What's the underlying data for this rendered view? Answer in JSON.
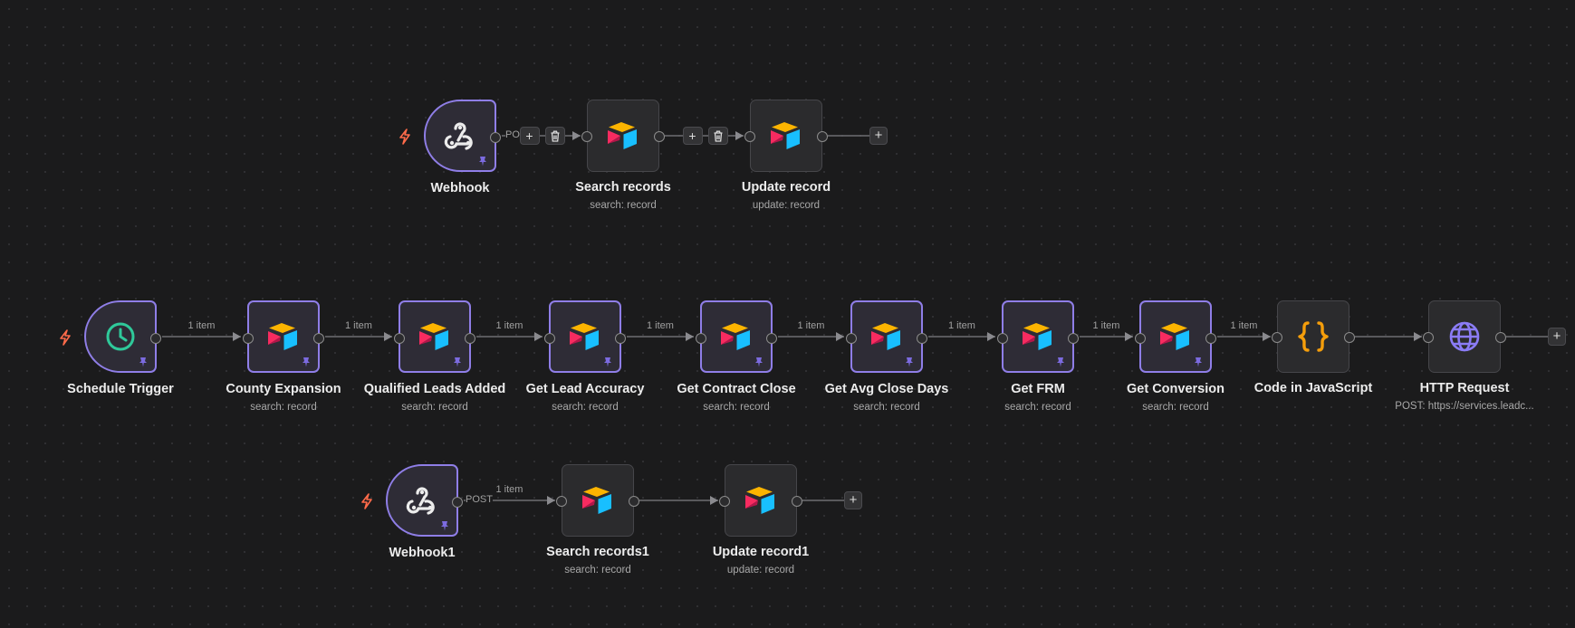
{
  "colors": {
    "canvas_bg": "#1b1b1c",
    "node_bg": "#2b2b2d",
    "pinned_border": "#8f7ee7",
    "trigger_bolt": "#ff6b4a",
    "schedule_icon": "#2fc99a",
    "code_icon": "#f59e0b",
    "http_icon": "#8b7cf6",
    "airtable_yellow": "#fcb400",
    "airtable_blue": "#18bfff",
    "airtable_red": "#f82b60"
  },
  "workflow_rows": [
    {
      "id": "row1",
      "nodes": [
        {
          "id": "webhook",
          "label": "Webhook",
          "subtitle": "",
          "icon": "webhook-icon",
          "trigger": true,
          "pinned": true
        },
        {
          "id": "search-records",
          "label": "Search records",
          "subtitle": "search: record",
          "icon": "airtable-icon",
          "trigger": false,
          "pinned": false
        },
        {
          "id": "update-record",
          "label": "Update record",
          "subtitle": "update: record",
          "icon": "airtable-icon",
          "trigger": false,
          "pinned": false
        }
      ],
      "edges": [
        {
          "from": "webhook",
          "to": "search-records",
          "label": "PO",
          "hover_controls": [
            "+",
            "delete"
          ]
        },
        {
          "from": "search-records",
          "to": "update-record",
          "label": "",
          "hover_controls": [
            "+",
            "delete"
          ]
        }
      ],
      "end_add": "+"
    },
    {
      "id": "row2",
      "nodes": [
        {
          "id": "schedule-trigger",
          "label": "Schedule Trigger",
          "subtitle": "",
          "icon": "clock-icon",
          "trigger": true,
          "pinned": true
        },
        {
          "id": "county-expansion",
          "label": "County Expansion",
          "subtitle": "search: record",
          "icon": "airtable-icon",
          "trigger": false,
          "pinned": true
        },
        {
          "id": "qualified-leads-added",
          "label": "Qualified Leads Added",
          "subtitle": "search: record",
          "icon": "airtable-icon",
          "trigger": false,
          "pinned": true
        },
        {
          "id": "get-lead-accuracy",
          "label": "Get Lead Accuracy",
          "subtitle": "search: record",
          "icon": "airtable-icon",
          "trigger": false,
          "pinned": true
        },
        {
          "id": "get-contract-close",
          "label": "Get Contract Close",
          "subtitle": "search: record",
          "icon": "airtable-icon",
          "trigger": false,
          "pinned": true
        },
        {
          "id": "get-avg-close-days",
          "label": "Get Avg Close Days",
          "subtitle": "search: record",
          "icon": "airtable-icon",
          "trigger": false,
          "pinned": true
        },
        {
          "id": "get-frm",
          "label": "Get FRM",
          "subtitle": "search: record",
          "icon": "airtable-icon",
          "trigger": false,
          "pinned": true
        },
        {
          "id": "get-conversion",
          "label": "Get Conversion",
          "subtitle": "search: record",
          "icon": "airtable-icon",
          "trigger": false,
          "pinned": true
        },
        {
          "id": "code-in-javascript",
          "label": "Code in JavaScript",
          "subtitle": "",
          "icon": "code-braces-icon",
          "trigger": false,
          "pinned": false
        },
        {
          "id": "http-request",
          "label": "HTTP Request",
          "subtitle": "POST: https://services.leadc...",
          "icon": "globe-icon",
          "trigger": false,
          "pinned": false
        }
      ],
      "edges": [
        {
          "from": "schedule-trigger",
          "to": "county-expansion",
          "label": "1 item"
        },
        {
          "from": "county-expansion",
          "to": "qualified-leads-added",
          "label": "1 item"
        },
        {
          "from": "qualified-leads-added",
          "to": "get-lead-accuracy",
          "label": "1 item"
        },
        {
          "from": "get-lead-accuracy",
          "to": "get-contract-close",
          "label": "1 item"
        },
        {
          "from": "get-contract-close",
          "to": "get-avg-close-days",
          "label": "1 item"
        },
        {
          "from": "get-avg-close-days",
          "to": "get-frm",
          "label": "1 item"
        },
        {
          "from": "get-frm",
          "to": "get-conversion",
          "label": "1 item"
        },
        {
          "from": "get-conversion",
          "to": "code-in-javascript",
          "label": "1 item"
        },
        {
          "from": "code-in-javascript",
          "to": "http-request",
          "label": ""
        }
      ],
      "end_add": "+"
    },
    {
      "id": "row3",
      "nodes": [
        {
          "id": "webhook1",
          "label": "Webhook1",
          "subtitle": "",
          "icon": "webhook-icon",
          "trigger": true,
          "pinned": true
        },
        {
          "id": "search-records1",
          "label": "Search records1",
          "subtitle": "search: record",
          "icon": "airtable-icon",
          "trigger": false,
          "pinned": false
        },
        {
          "id": "update-record1",
          "label": "Update record1",
          "subtitle": "update: record",
          "icon": "airtable-icon",
          "trigger": false,
          "pinned": false
        }
      ],
      "edges": [
        {
          "from": "webhook1",
          "to": "search-records1",
          "label": "1 item",
          "method": "POST"
        },
        {
          "from": "search-records1",
          "to": "update-record1",
          "label": ""
        }
      ],
      "end_add": "+"
    }
  ]
}
